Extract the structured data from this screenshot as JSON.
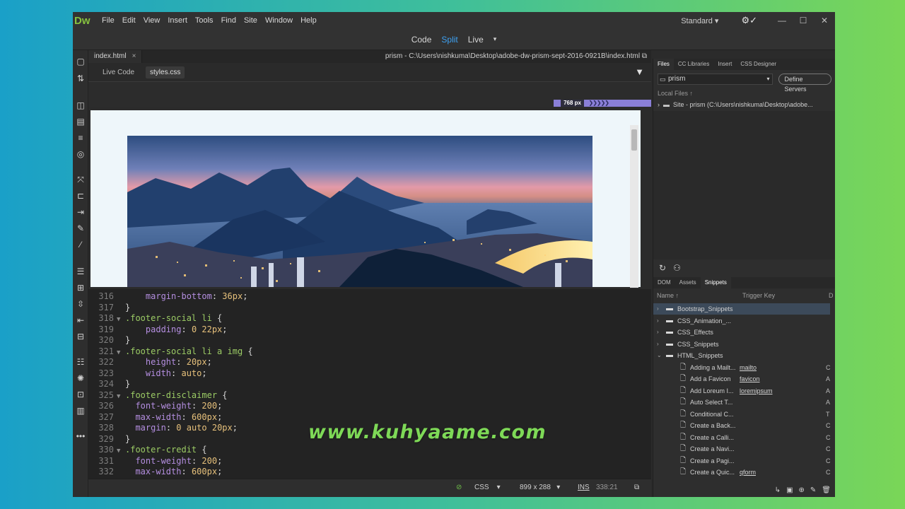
{
  "app": {
    "logo": "Dw",
    "menu": [
      "File",
      "Edit",
      "View",
      "Insert",
      "Tools",
      "Find",
      "Site",
      "Window",
      "Help"
    ],
    "workspace": "Standard",
    "workspace_caret": "▾",
    "sync_icon": "⚙✓"
  },
  "views": {
    "code": "Code",
    "split": "Split",
    "live": "Live",
    "live_caret": "▾"
  },
  "document": {
    "tab": "index.html",
    "path": "prism - C:\\Users\\nishkuma\\Desktop\\adobe-dw-prism-sept-2016-0921B\\index.html",
    "related": [
      "Live Code",
      "styles.css"
    ]
  },
  "media_query": {
    "width_label": "768 px",
    "arrows": "❯❯❯❯❯"
  },
  "code_lines": [
    {
      "n": "316",
      "fold": "",
      "indent": "    ",
      "parts": [
        [
          "prop",
          "margin-bottom"
        ],
        [
          "punc",
          ": "
        ],
        [
          "val",
          "36px"
        ],
        [
          "punc",
          ";"
        ]
      ]
    },
    {
      "n": "317",
      "fold": "",
      "indent": "",
      "parts": [
        [
          "punc",
          "}"
        ]
      ]
    },
    {
      "n": "318",
      "fold": "▼",
      "indent": "",
      "parts": [
        [
          "sel",
          ".footer-social li"
        ],
        [
          "punc",
          " {"
        ]
      ]
    },
    {
      "n": "319",
      "fold": "",
      "indent": "    ",
      "parts": [
        [
          "prop",
          "padding"
        ],
        [
          "punc",
          ": "
        ],
        [
          "val",
          "0 22px"
        ],
        [
          "punc",
          ";"
        ]
      ]
    },
    {
      "n": "320",
      "fold": "",
      "indent": "",
      "parts": [
        [
          "punc",
          "}"
        ]
      ]
    },
    {
      "n": "321",
      "fold": "▼",
      "indent": "",
      "parts": [
        [
          "sel",
          ".footer-social li a img"
        ],
        [
          "punc",
          " {"
        ]
      ]
    },
    {
      "n": "322",
      "fold": "",
      "indent": "    ",
      "parts": [
        [
          "prop",
          "height"
        ],
        [
          "punc",
          ": "
        ],
        [
          "val",
          "20px"
        ],
        [
          "punc",
          ";"
        ]
      ]
    },
    {
      "n": "323",
      "fold": "",
      "indent": "    ",
      "parts": [
        [
          "prop",
          "width"
        ],
        [
          "punc",
          ": "
        ],
        [
          "val",
          "auto"
        ],
        [
          "punc",
          ";"
        ]
      ]
    },
    {
      "n": "324",
      "fold": "",
      "indent": "",
      "parts": [
        [
          "punc",
          "}"
        ]
      ]
    },
    {
      "n": "325",
      "fold": "▼",
      "indent": "",
      "parts": [
        [
          "sel",
          ".footer-disclaimer"
        ],
        [
          "punc",
          " {"
        ]
      ]
    },
    {
      "n": "326",
      "fold": "",
      "indent": "  ",
      "parts": [
        [
          "prop",
          "font-weight"
        ],
        [
          "punc",
          ": "
        ],
        [
          "val",
          "200"
        ],
        [
          "punc",
          ";"
        ]
      ]
    },
    {
      "n": "327",
      "fold": "",
      "indent": "  ",
      "parts": [
        [
          "prop",
          "max-width"
        ],
        [
          "punc",
          ": "
        ],
        [
          "val",
          "600px"
        ],
        [
          "punc",
          ";"
        ]
      ]
    },
    {
      "n": "328",
      "fold": "",
      "indent": "  ",
      "parts": [
        [
          "prop",
          "margin"
        ],
        [
          "punc",
          ": "
        ],
        [
          "val",
          "0 auto 20px"
        ],
        [
          "punc",
          ";"
        ]
      ]
    },
    {
      "n": "329",
      "fold": "",
      "indent": "",
      "parts": [
        [
          "punc",
          "}"
        ]
      ]
    },
    {
      "n": "330",
      "fold": "▼",
      "indent": "",
      "parts": [
        [
          "sel",
          ".footer-credit"
        ],
        [
          "punc",
          " {"
        ]
      ]
    },
    {
      "n": "331",
      "fold": "",
      "indent": "  ",
      "parts": [
        [
          "prop",
          "font-weight"
        ],
        [
          "punc",
          ": "
        ],
        [
          "val",
          "200"
        ],
        [
          "punc",
          ";"
        ]
      ]
    },
    {
      "n": "332",
      "fold": "",
      "indent": "  ",
      "parts": [
        [
          "prop",
          "max-width"
        ],
        [
          "punc",
          ": "
        ],
        [
          "val",
          "600px"
        ],
        [
          "punc",
          ";"
        ]
      ]
    }
  ],
  "status": {
    "language": "CSS",
    "size": "899 x 288",
    "mode": "INS",
    "position": "338:21"
  },
  "files_panel": {
    "tabs": [
      "Files",
      "CC Libraries",
      "Insert",
      "CSS Designer"
    ],
    "site": "prism",
    "define_servers": "Define Servers",
    "local_files": "Local Files ↑",
    "site_item": "Site - prism (C:\\Users\\nishkuma\\Desktop\\adobe..."
  },
  "snippets_panel": {
    "tabs": [
      "DOM",
      "Assets",
      "Snippets"
    ],
    "col_name": "Name ↑",
    "col_trigger": "Trigger Key",
    "col_d": "D",
    "folders": [
      "Bootstrap_Snippets",
      "CSS_Animation_...",
      "CSS_Effects",
      "CSS_Snippets",
      "HTML_Snippets"
    ],
    "items": [
      {
        "name": "Adding a Mailt...",
        "trigger": "mailto",
        "d": "C"
      },
      {
        "name": "Add a Favicon",
        "trigger": "favicon",
        "d": "A"
      },
      {
        "name": "Add Loreum I...",
        "trigger": "loremipsum",
        "d": "A"
      },
      {
        "name": "Auto Select T...",
        "trigger": "",
        "d": "A"
      },
      {
        "name": "Conditional C...",
        "trigger": "",
        "d": "T"
      },
      {
        "name": "Create a Back...",
        "trigger": "",
        "d": "C"
      },
      {
        "name": "Create a Calli...",
        "trigger": "",
        "d": "C"
      },
      {
        "name": "Create a Navi...",
        "trigger": "",
        "d": "C"
      },
      {
        "name": "Create a Pagi...",
        "trigger": "",
        "d": "C"
      },
      {
        "name": "Create a Quic...",
        "trigger": "qform",
        "d": "C"
      }
    ]
  },
  "watermark": "www.kuhyaame.com"
}
